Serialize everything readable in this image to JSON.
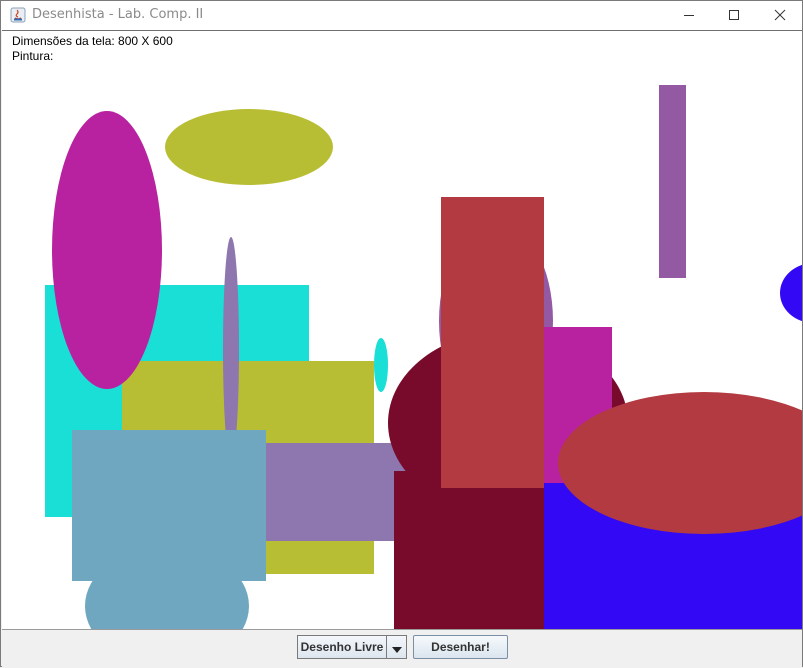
{
  "window": {
    "title": "Desenhista - Lab. Comp. II"
  },
  "canvas": {
    "dimensions_label": "Dimensões da tela: 800 X 600",
    "painting_label": "Pintura:",
    "colors": {
      "cyan": "#1ADFD6",
      "olive": "#B8BE34",
      "magenta": "#B822A0",
      "lavender": "#8E76AE",
      "steel_blue": "#6FA7C0",
      "maroon": "#780A2B",
      "brick": "#B43A41",
      "purple": "#9459A3",
      "blue": "#3208F5",
      "white": "#FFFFFF"
    }
  },
  "toolbar": {
    "mode_select_value": "Desenho Livre",
    "draw_button_label": "Desenhar!"
  },
  "icons": {
    "app": "java-app-icon",
    "minimize": "minimize-icon",
    "maximize": "maximize-icon",
    "close": "close-icon",
    "dropdown": "chevron-down-icon"
  }
}
